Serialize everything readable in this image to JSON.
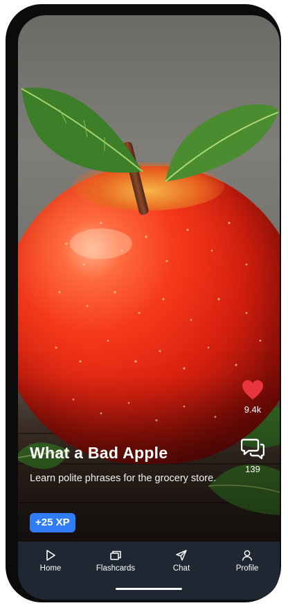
{
  "post": {
    "title": "What a Bad Apple",
    "description": "Learn polite phrases for the grocery store.",
    "xp_badge": "+25 XP",
    "image": "red-apple-photo"
  },
  "actions": {
    "like_count": "9.4k",
    "comment_count": "139",
    "like_icon": "heart-icon",
    "comment_icon": "chat-bubbles-icon"
  },
  "nav": {
    "items": [
      {
        "label": "Home",
        "icon": "play-icon"
      },
      {
        "label": "Flashcards",
        "icon": "cards-icon"
      },
      {
        "label": "Chat",
        "icon": "send-icon"
      },
      {
        "label": "Profile",
        "icon": "user-icon"
      }
    ]
  },
  "colors": {
    "accent": "#2f7cf6",
    "like": "#e8343d",
    "nav_bg": "#1f2733"
  }
}
